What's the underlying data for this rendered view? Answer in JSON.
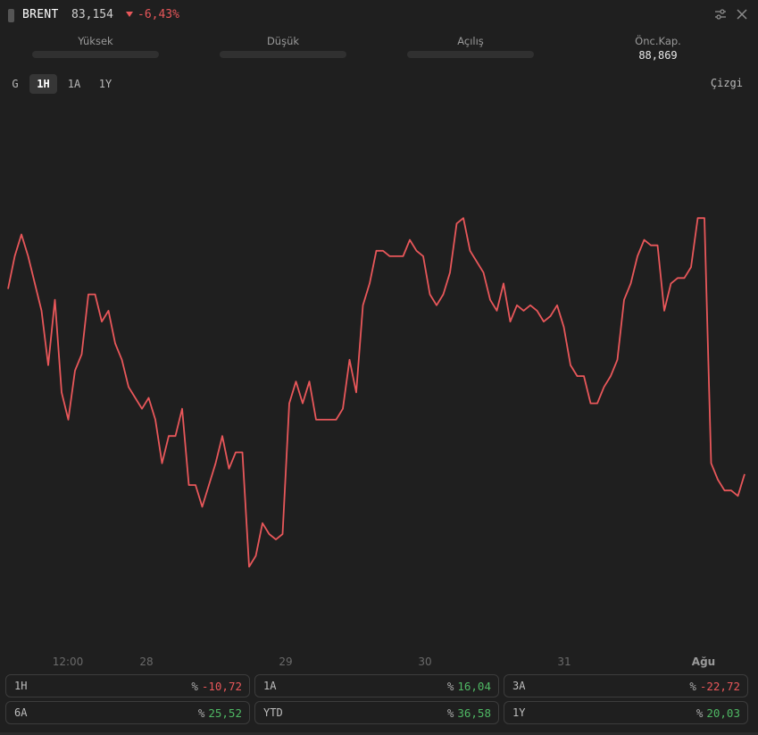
{
  "header": {
    "symbol": "BRENT",
    "price": "83,154",
    "change": "-6,43%",
    "settings_icon": "sliders-icon",
    "close_icon": "close-icon"
  },
  "stats": [
    {
      "label": "Yüksek",
      "value": ""
    },
    {
      "label": "Düşük",
      "value": ""
    },
    {
      "label": "Açılış",
      "value": ""
    },
    {
      "label": "Önc.Kap.",
      "value": "88,869"
    }
  ],
  "range_tabs": [
    {
      "label": "G",
      "active": false
    },
    {
      "label": "1H",
      "active": true
    },
    {
      "label": "1A",
      "active": false
    },
    {
      "label": "1Y",
      "active": false
    }
  ],
  "chart_type_label": "Çizgi",
  "colors": {
    "line": "#e8575a",
    "negative": "#e8575a",
    "positive": "#4fb864",
    "background": "#1f1f1f"
  },
  "chart_data": {
    "type": "line",
    "x_ticks": [
      "12:00",
      "28",
      "29",
      "30",
      "31",
      "Ağu"
    ],
    "highlighted_tick": "Ağu",
    "ylim": [
      0,
      100
    ],
    "y_axis_visible": false,
    "grid": false,
    "series": [
      {
        "values": [
          65,
          71,
          75,
          71,
          66,
          61,
          51,
          63,
          46,
          41,
          50,
          53,
          64,
          64,
          59,
          61,
          55,
          52,
          47,
          45,
          43,
          45,
          41,
          33,
          38,
          38,
          43,
          29,
          29,
          25,
          29,
          33,
          38,
          32,
          35,
          35,
          14,
          16,
          22,
          20,
          19,
          20,
          44,
          48,
          44,
          48,
          41,
          41,
          41,
          41,
          43,
          52,
          46,
          62,
          66,
          72,
          72,
          71,
          71,
          71,
          74,
          72,
          71,
          64,
          62,
          64,
          68,
          77,
          78,
          72,
          70,
          68,
          63,
          61,
          66,
          59,
          62,
          61,
          62,
          61,
          59,
          60,
          62,
          58,
          51,
          49,
          49,
          44,
          44,
          47,
          49,
          52,
          63,
          66,
          71,
          74,
          73,
          73,
          61,
          66,
          67,
          67,
          69,
          78,
          78,
          33,
          30,
          28,
          28,
          27,
          31
        ]
      }
    ]
  },
  "performance": [
    {
      "label": "1H",
      "value": "-10,72",
      "dir": "neg"
    },
    {
      "label": "1A",
      "value": "16,04",
      "dir": "pos"
    },
    {
      "label": "3A",
      "value": "-22,72",
      "dir": "neg"
    },
    {
      "label": "6A",
      "value": "25,52",
      "dir": "pos"
    },
    {
      "label": "YTD",
      "value": "36,58",
      "dir": "pos"
    },
    {
      "label": "1Y",
      "value": "20,03",
      "dir": "pos"
    }
  ],
  "percent_sign": "%"
}
